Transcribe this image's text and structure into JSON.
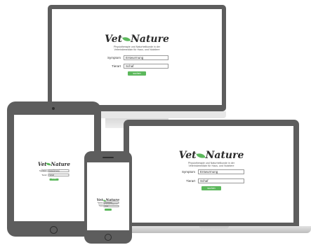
{
  "brand": {
    "name_part1": "Vet",
    "name_part2": "Nature",
    "tagline_line1": "Physiotherapie und Naturheilkunde in der",
    "tagline_line2": "Veterinärmedizin für Haus- und Nutztiere"
  },
  "form": {
    "symptom_label": "Symptom",
    "symptom_value": "Entwurmung",
    "tierart_label": "Tierart",
    "tierart_value": "Schaf",
    "submit_label": "suchen"
  },
  "colors": {
    "accent_green": "#5cb85c",
    "device_frame": "#5d5d5d"
  }
}
